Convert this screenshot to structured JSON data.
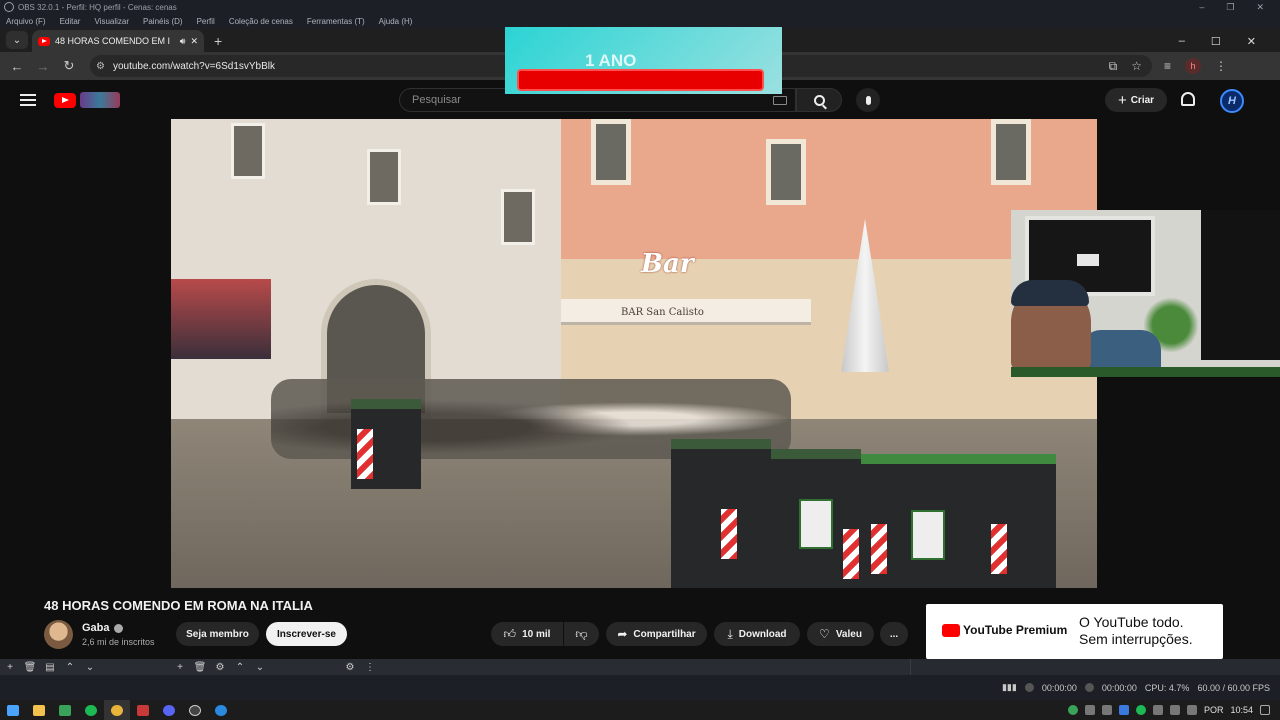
{
  "obs": {
    "title": "OBS 32.0.1 - Perfil: HQ perfil - Cenas: cenas",
    "menu": [
      "Arquivo (F)",
      "Editar",
      "Visualizar",
      "Painéis (D)",
      "Perfil",
      "Coleção de cenas",
      "Ferramentas (T)",
      "Ajuda (H)"
    ],
    "status": {
      "rec_time1": "00:00:00",
      "rec_time2": "00:00:00",
      "cpu": "CPU: 4.7%",
      "fps": "60.00 / 60.00 FPS"
    }
  },
  "browser": {
    "tab_title": "48 HORAS COMENDO EM I",
    "url": "youtube.com/watch?v=6Sd1svYbBlk",
    "profile_letter": "h"
  },
  "youtube": {
    "search_placeholder": "Pesquisar",
    "create_label": "Criar",
    "user_initial": "H",
    "anniversary_text": "1 ANO",
    "video": {
      "shop_sign": "Bar",
      "awning_text": "BAR San Calisto",
      "title": "48 HORAS COMENDO EM ROMA NA ITALIA",
      "channel": "Gaba",
      "subscribers": "2,6 mi de inscritos",
      "member_label": "Seja membro",
      "subscribe_label": "Inscrever-se",
      "likes": "10 mil",
      "share_label": "Compartilhar",
      "download_label": "Download",
      "thanks_label": "Valeu",
      "more_label": "..."
    },
    "premium_ad": {
      "logo_text": "YouTube Premium",
      "line1": "O YouTube todo.",
      "line2": "Sem interrupções."
    }
  },
  "taskbar": {
    "lang": "POR",
    "time": "10:54"
  },
  "colors": {
    "yt_red": "#ff0000",
    "bg": "#0f0f0f",
    "pill": "#272727"
  }
}
